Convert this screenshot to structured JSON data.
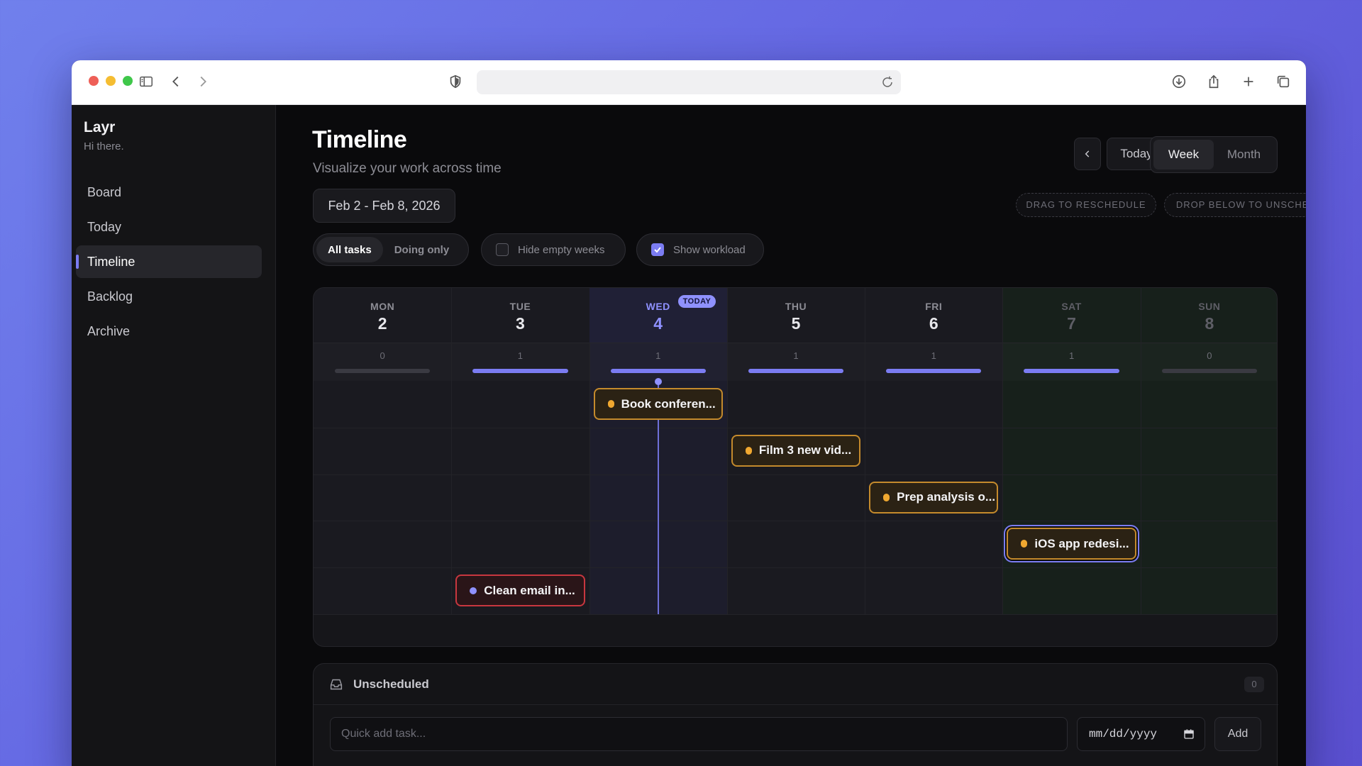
{
  "app": {
    "name": "Layr",
    "greeting": "Hi there."
  },
  "sidebar": {
    "items": [
      {
        "label": "Board"
      },
      {
        "label": "Today"
      },
      {
        "label": "Timeline",
        "active": true
      },
      {
        "label": "Backlog"
      },
      {
        "label": "Archive"
      }
    ]
  },
  "header": {
    "title": "Timeline",
    "subtitle": "Visualize your work across time",
    "date_range": "Feb 2 - Feb 8, 2026",
    "today_label": "Today",
    "prev_icon": "chevron-left-icon",
    "next_icon": "chevron-right-icon",
    "views": [
      {
        "label": "Week",
        "active": true
      },
      {
        "label": "Month",
        "active": false
      }
    ],
    "hints": [
      "DRAG TO RESCHEDULE",
      "DROP BELOW TO UNSCHEDULE"
    ]
  },
  "filters": {
    "scope": [
      {
        "label": "All tasks",
        "active": true
      },
      {
        "label": "Doing only",
        "active": false
      }
    ],
    "hide_empty_weeks": {
      "label": "Hide empty weeks",
      "checked": false
    },
    "show_workload": {
      "label": "Show workload",
      "checked": true
    }
  },
  "calendar": {
    "today_badge": "TODAY",
    "days": [
      {
        "name": "MON",
        "num": "2",
        "load": 0
      },
      {
        "name": "TUE",
        "num": "3",
        "load": 1
      },
      {
        "name": "WED",
        "num": "4",
        "load": 1,
        "today": true
      },
      {
        "name": "THU",
        "num": "5",
        "load": 1
      },
      {
        "name": "FRI",
        "num": "6",
        "load": 1
      },
      {
        "name": "SAT",
        "num": "7",
        "load": 1,
        "weekend": true
      },
      {
        "name": "SUN",
        "num": "8",
        "load": 0,
        "weekend": true
      }
    ],
    "tasks": [
      {
        "title": "Book conferen...",
        "day": 2,
        "row": 0,
        "priority": "amber"
      },
      {
        "title": "Film 3 new vid...",
        "day": 3,
        "row": 1,
        "priority": "amber"
      },
      {
        "title": "Prep analysis o...",
        "day": 4,
        "row": 2,
        "priority": "amber"
      },
      {
        "title": "iOS app redesi...",
        "day": 5,
        "row": 3,
        "priority": "amber",
        "selected": true
      },
      {
        "title": "Clean email in...",
        "day": 1,
        "row": 4,
        "priority": "violet"
      }
    ]
  },
  "unscheduled": {
    "title": "Unscheduled",
    "count": "0",
    "quick_add_placeholder": "Quick add task...",
    "date_placeholder": "mm/dd/yyyy",
    "add_label": "Add"
  },
  "colors": {
    "accent": "#7b7cf2",
    "today": "#8f91ff",
    "warn_border": "#c48a2c",
    "urgent_border": "#c8373f"
  }
}
